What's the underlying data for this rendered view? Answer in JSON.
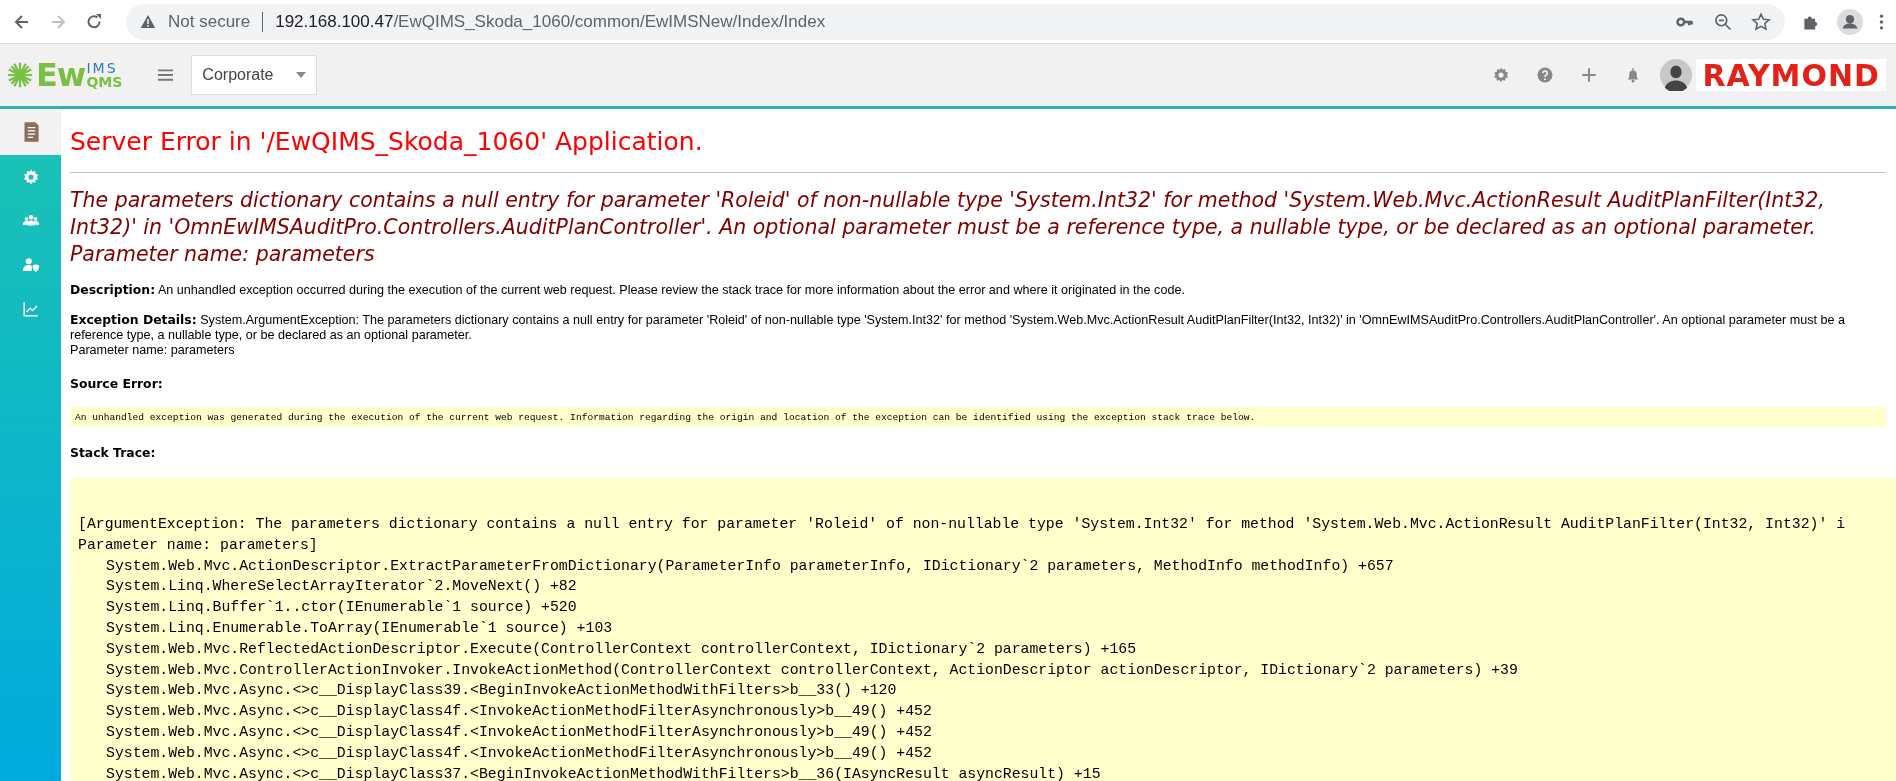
{
  "browser": {
    "security": "Not secure",
    "url_host": "192.168.100.47",
    "url_path": "/EwQIMS_Skoda_1060/common/EwIMSNew/Index/Index"
  },
  "header": {
    "logo": {
      "main": "Ew",
      "top": "IMS",
      "bottom": "QMS"
    },
    "company": "Corporate",
    "brand": "RAYMOND"
  },
  "sidebar": {
    "items": [
      {
        "kind": "document",
        "selected": true
      },
      {
        "kind": "gear",
        "selected": false
      },
      {
        "kind": "users",
        "selected": false
      },
      {
        "kind": "user-shield",
        "selected": false
      },
      {
        "kind": "chart",
        "selected": false
      }
    ]
  },
  "error": {
    "title": "Server Error in '/EwQIMS_Skoda_1060' Application.",
    "message": "The parameters dictionary contains a null entry for parameter 'Roleid' of non-nullable type 'System.Int32' for method 'System.Web.Mvc.ActionResult AuditPlanFilter(Int32, Int32)' in 'OmnEwIMSAuditPro.Controllers.AuditPlanController'. An optional parameter must be a reference type, a nullable type, or be declared as an optional parameter.",
    "message_param": "Parameter name: parameters",
    "description": {
      "label": "Description:",
      "text": "An unhandled exception occurred during the execution of the current web request. Please review the stack trace for more information about the error and where it originated in the code."
    },
    "exception_details": {
      "label": "Exception Details:",
      "text": "System.ArgumentException: The parameters dictionary contains a null entry for parameter 'Roleid' of non-nullable type 'System.Int32' for method 'System.Web.Mvc.ActionResult AuditPlanFilter(Int32, Int32)' in 'OmnEwIMSAuditPro.Controllers.AuditPlanController'. An optional parameter must be a reference type, a nullable type, or be declared as an optional parameter.",
      "param": "Parameter name: parameters"
    },
    "source_error": {
      "label": "Source Error:",
      "text": "An unhandled exception was generated during the execution of the current web request. Information regarding the origin and location of the exception can be identified using the exception stack trace below."
    },
    "stack_trace": {
      "label": "Stack Trace:",
      "exception": [
        "[ArgumentException: The parameters dictionary contains a null entry for parameter 'Roleid' of non-nullable type 'System.Int32' for method 'System.Web.Mvc.ActionResult AuditPlanFilter(Int32, Int32)' i",
        "Parameter name: parameters]"
      ],
      "frames": [
        "System.Web.Mvc.ActionDescriptor.ExtractParameterFromDictionary(ParameterInfo parameterInfo, IDictionary`2 parameters, MethodInfo methodInfo) +657",
        "System.Linq.WhereSelectArrayIterator`2.MoveNext() +82",
        "System.Linq.Buffer`1..ctor(IEnumerable`1 source) +520",
        "System.Linq.Enumerable.ToArray(IEnumerable`1 source) +103",
        "System.Web.Mvc.ReflectedActionDescriptor.Execute(ControllerContext controllerContext, IDictionary`2 parameters) +165",
        "System.Web.Mvc.ControllerActionInvoker.InvokeActionMethod(ControllerContext controllerContext, ActionDescriptor actionDescriptor, IDictionary`2 parameters) +39",
        "System.Web.Mvc.Async.<>c__DisplayClass39.<BeginInvokeActionMethodWithFilters>b__33() +120",
        "System.Web.Mvc.Async.<>c__DisplayClass4f.<InvokeActionMethodFilterAsynchronously>b__49() +452",
        "System.Web.Mvc.Async.<>c__DisplayClass4f.<InvokeActionMethodFilterAsynchronously>b__49() +452",
        "System.Web.Mvc.Async.<>c__DisplayClass4f.<InvokeActionMethodFilterAsynchronously>b__49() +452",
        "System.Web.Mvc.Async.<>c__DisplayClass37.<BeginInvokeActionMethodWithFilters>b__36(IAsyncResult asyncResult) +15"
      ]
    }
  }
}
